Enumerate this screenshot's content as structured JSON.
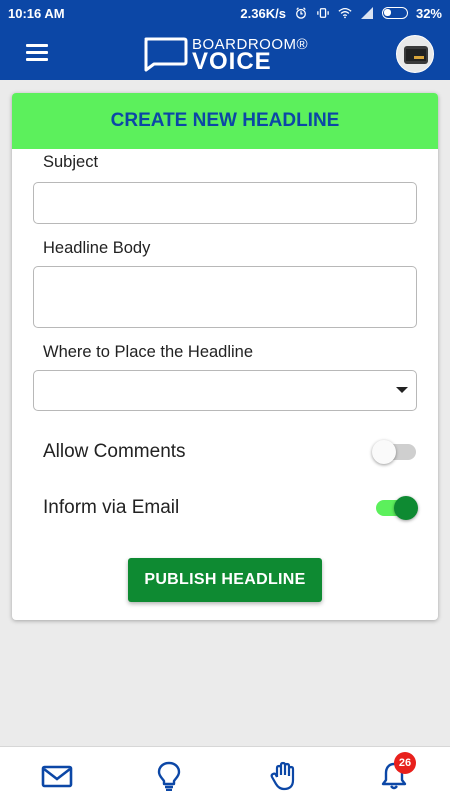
{
  "status_bar": {
    "time": "10:16 AM",
    "network_speed": "2.36K/s",
    "battery": "32%"
  },
  "app_bar": {
    "brand_top": "BOARDROOM®",
    "brand_bottom": "VOICE"
  },
  "form": {
    "title": "CREATE NEW HEADLINE",
    "subject": {
      "label": "Subject",
      "value": ""
    },
    "body": {
      "label": "Headline Body",
      "value": ""
    },
    "placement": {
      "label": "Where to Place the Headline",
      "selected": ""
    },
    "allow_comments": {
      "label": "Allow Comments",
      "on": false
    },
    "inform_email": {
      "label": "Inform via Email",
      "on": true
    },
    "submit_label": "PUBLISH HEADLINE"
  },
  "bottom_nav": {
    "items": [
      {
        "icon": "envelope-icon"
      },
      {
        "icon": "lightbulb-icon"
      },
      {
        "icon": "raised-hand-icon"
      },
      {
        "icon": "bell-icon"
      }
    ],
    "notification_count": "26"
  },
  "colors": {
    "primary": "#0c47a6",
    "header_green": "#5cf05c",
    "button_green": "#0e8a32",
    "badge_red": "#e8201c"
  }
}
